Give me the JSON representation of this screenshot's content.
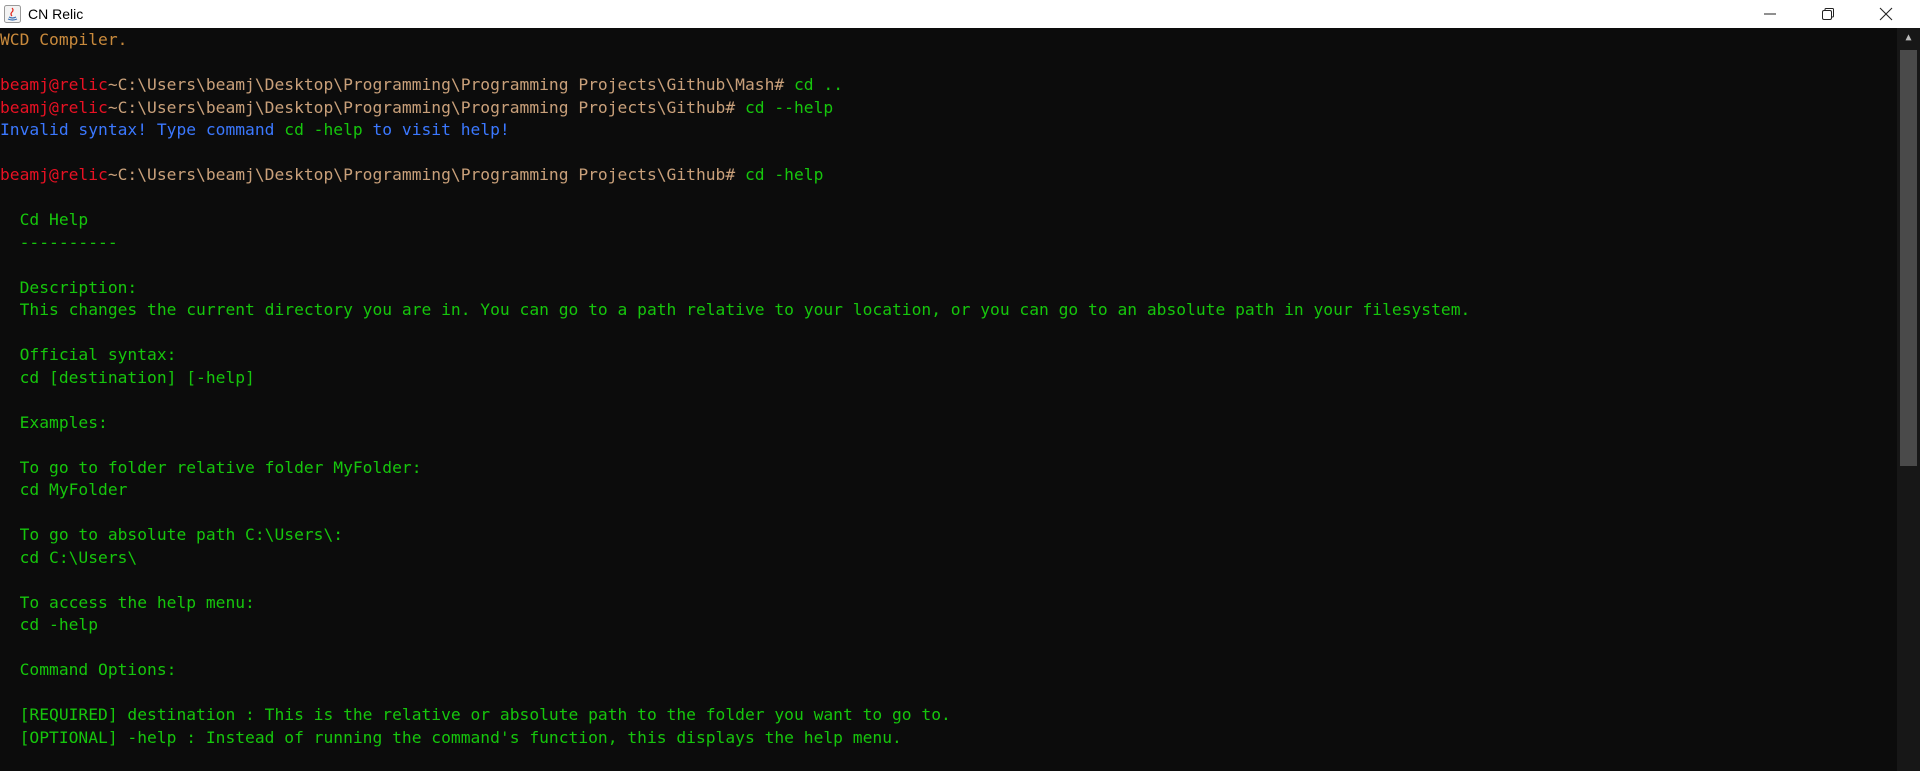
{
  "window": {
    "title": "CN Relic",
    "minimize_label": "",
    "maximize_label": "",
    "close_label": ""
  },
  "console": {
    "lines": [
      {
        "type": "output",
        "text": "WCD Compiler."
      },
      {
        "type": "blank"
      },
      {
        "type": "prompt",
        "user": "beamj@relic",
        "path": "~C:\\Users\\beamj\\Desktop\\Programming\\Programming Projects\\Github\\Mash#",
        "command": " cd .."
      },
      {
        "type": "prompt",
        "user": "beamj@relic",
        "path": "~C:\\Users\\beamj\\Desktop\\Programming\\Programming Projects\\Github#",
        "command": " cd --help"
      },
      {
        "type": "error",
        "parts": [
          "Invalid syntax! Type command ",
          "cd -help",
          " to visit help!"
        ]
      },
      {
        "type": "blank"
      },
      {
        "type": "prompt",
        "user": "beamj@relic",
        "path": "~C:\\Users\\beamj\\Desktop\\Programming\\Programming Projects\\Github#",
        "command": " cd -help"
      },
      {
        "type": "blank"
      },
      {
        "type": "help",
        "text": "  Cd Help"
      },
      {
        "type": "help",
        "text": "  ----------"
      },
      {
        "type": "blank"
      },
      {
        "type": "help",
        "text": "  Description:"
      },
      {
        "type": "help",
        "text": "  This changes the current directory you are in. You can go to a path relative to your location, or you can go to an absolute path in your filesystem."
      },
      {
        "type": "blank"
      },
      {
        "type": "help",
        "text": "  Official syntax:"
      },
      {
        "type": "help",
        "text": "  cd [destination] [-help]"
      },
      {
        "type": "blank"
      },
      {
        "type": "help",
        "text": "  Examples:"
      },
      {
        "type": "blank"
      },
      {
        "type": "help",
        "text": "  To go to folder relative folder MyFolder:"
      },
      {
        "type": "help",
        "text": "  cd MyFolder"
      },
      {
        "type": "blank"
      },
      {
        "type": "help",
        "text": "  To go to absolute path C:\\Users\\:"
      },
      {
        "type": "help",
        "text": "  cd C:\\Users\\"
      },
      {
        "type": "blank"
      },
      {
        "type": "help",
        "text": "  To access the help menu:"
      },
      {
        "type": "help",
        "text": "  cd -help"
      },
      {
        "type": "blank"
      },
      {
        "type": "help",
        "text": "  Command Options:"
      },
      {
        "type": "blank"
      },
      {
        "type": "help",
        "text": "  [REQUIRED] destination : This is the relative or absolute path to the folder you want to go to."
      },
      {
        "type": "help",
        "text": "  [OPTIONAL] -help : Instead of running the command's function, this displays the help menu."
      }
    ]
  },
  "colors": {
    "background": "#0c0c0c",
    "prompt_user": "#e81123",
    "prompt_path": "#c9a07a",
    "command": "#16c60c",
    "error": "#3b78ff",
    "output": "#c98a3c"
  }
}
